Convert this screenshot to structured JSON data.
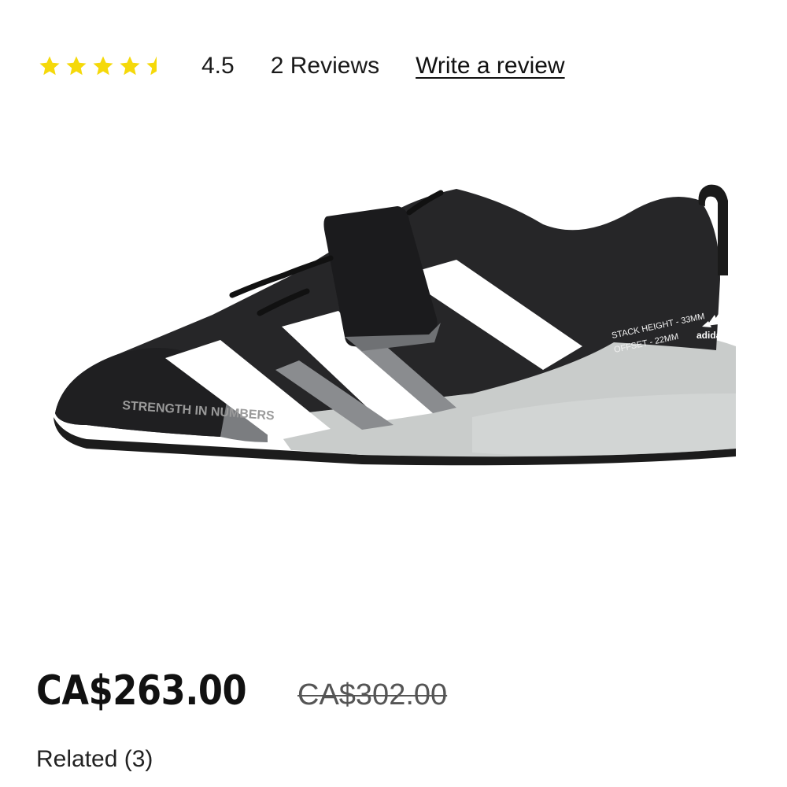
{
  "rating": {
    "stars_filled": 4.5,
    "stars_total": 5,
    "star_color": "#f5d90a",
    "value_text": "4.5",
    "reviews_text": "2 Reviews",
    "write_review_text": "Write a review"
  },
  "product_image": {
    "alt": "adidas weightlifting shoe",
    "side_text": "STRENGTH IN NUMBERS",
    "heel_text_line1": "STACK HEIGHT - 33MM",
    "heel_text_line2": "OFFSET - 22MM",
    "brand_text": "adidas"
  },
  "pricing": {
    "current_price": "CA$263.00",
    "original_price": "CA$302.00"
  },
  "related": {
    "label": "Related (3)"
  }
}
